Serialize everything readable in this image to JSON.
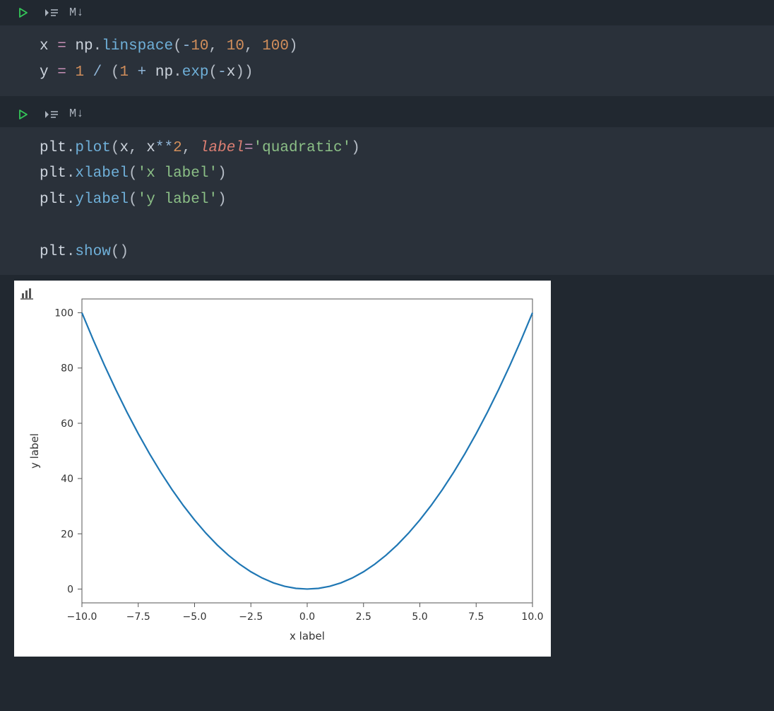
{
  "toolbar": {
    "markdown_label": "M↓"
  },
  "cells": [
    {
      "code_tokens": [
        [
          {
            "t": "x ",
            "c": "id"
          },
          {
            "t": "= ",
            "c": "eq"
          },
          {
            "t": "np",
            "c": "id"
          },
          {
            "t": ".",
            "c": "pu"
          },
          {
            "t": "linspace",
            "c": "fn"
          },
          {
            "t": "(",
            "c": "pu"
          },
          {
            "t": "-",
            "c": "op"
          },
          {
            "t": "10",
            "c": "nm"
          },
          {
            "t": ", ",
            "c": "pu"
          },
          {
            "t": "10",
            "c": "nm"
          },
          {
            "t": ", ",
            "c": "pu"
          },
          {
            "t": "100",
            "c": "nm"
          },
          {
            "t": ")",
            "c": "pu"
          }
        ],
        [
          {
            "t": "y ",
            "c": "id"
          },
          {
            "t": "= ",
            "c": "eq"
          },
          {
            "t": "1",
            "c": "nm"
          },
          {
            "t": " / ",
            "c": "op"
          },
          {
            "t": "(",
            "c": "pu"
          },
          {
            "t": "1",
            "c": "nm"
          },
          {
            "t": " + ",
            "c": "op"
          },
          {
            "t": "np",
            "c": "id"
          },
          {
            "t": ".",
            "c": "pu"
          },
          {
            "t": "exp",
            "c": "fn"
          },
          {
            "t": "(",
            "c": "pu"
          },
          {
            "t": "-",
            "c": "op"
          },
          {
            "t": "x",
            "c": "id"
          },
          {
            "t": "))",
            "c": "pu"
          }
        ]
      ]
    },
    {
      "code_tokens": [
        [
          {
            "t": "plt",
            "c": "id"
          },
          {
            "t": ".",
            "c": "pu"
          },
          {
            "t": "plot",
            "c": "fn"
          },
          {
            "t": "(",
            "c": "pu"
          },
          {
            "t": "x",
            "c": "id"
          },
          {
            "t": ", ",
            "c": "pu"
          },
          {
            "t": "x",
            "c": "id"
          },
          {
            "t": "**",
            "c": "op"
          },
          {
            "t": "2",
            "c": "nm"
          },
          {
            "t": ", ",
            "c": "pu"
          },
          {
            "t": "label",
            "c": "kw"
          },
          {
            "t": "=",
            "c": "eq"
          },
          {
            "t": "'quadratic'",
            "c": "st"
          },
          {
            "t": ")",
            "c": "pu"
          }
        ],
        [
          {
            "t": "plt",
            "c": "id"
          },
          {
            "t": ".",
            "c": "pu"
          },
          {
            "t": "xlabel",
            "c": "fn"
          },
          {
            "t": "(",
            "c": "pu"
          },
          {
            "t": "'x label'",
            "c": "st"
          },
          {
            "t": ")",
            "c": "pu"
          }
        ],
        [
          {
            "t": "plt",
            "c": "id"
          },
          {
            "t": ".",
            "c": "pu"
          },
          {
            "t": "ylabel",
            "c": "fn"
          },
          {
            "t": "(",
            "c": "pu"
          },
          {
            "t": "'y label'",
            "c": "st"
          },
          {
            "t": ")",
            "c": "pu"
          }
        ],
        [],
        [
          {
            "t": "plt",
            "c": "id"
          },
          {
            "t": ".",
            "c": "pu"
          },
          {
            "t": "show",
            "c": "fn"
          },
          {
            "t": "()",
            "c": "pu"
          }
        ]
      ]
    }
  ],
  "chart_data": {
    "type": "line",
    "xlabel": "x label",
    "ylabel": "y label",
    "xlim": [
      -10,
      10
    ],
    "ylim": [
      -5,
      105
    ],
    "xticks": [
      -10.0,
      -7.5,
      -5.0,
      -2.5,
      0.0,
      2.5,
      5.0,
      7.5,
      10.0
    ],
    "yticks": [
      0,
      20,
      40,
      60,
      80,
      100
    ],
    "series": [
      {
        "name": "quadratic",
        "x": [
          -10,
          -9.5,
          -9,
          -8.5,
          -8,
          -7.5,
          -7,
          -6.5,
          -6,
          -5.5,
          -5,
          -4.5,
          -4,
          -3.5,
          -3,
          -2.5,
          -2,
          -1.5,
          -1,
          -0.5,
          0,
          0.5,
          1,
          1.5,
          2,
          2.5,
          3,
          3.5,
          4,
          4.5,
          5,
          5.5,
          6,
          6.5,
          7,
          7.5,
          8,
          8.5,
          9,
          9.5,
          10
        ],
        "y": [
          100,
          90.25,
          81,
          72.25,
          64,
          56.25,
          49,
          42.25,
          36,
          30.25,
          25,
          20.25,
          16,
          12.25,
          9,
          6.25,
          4,
          2.25,
          1,
          0.25,
          0,
          0.25,
          1,
          2.25,
          4,
          6.25,
          9,
          12.25,
          16,
          20.25,
          25,
          30.25,
          36,
          42.25,
          49,
          56.25,
          64,
          72.25,
          81,
          90.25,
          100
        ]
      }
    ]
  }
}
